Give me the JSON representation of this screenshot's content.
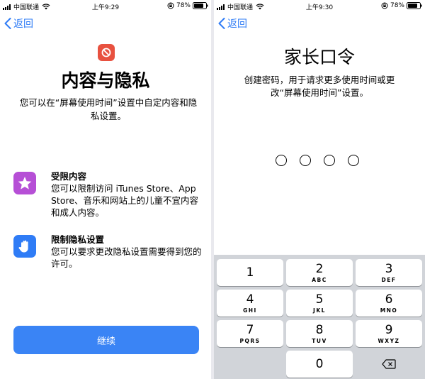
{
  "left": {
    "status": {
      "carrier": "中国联通",
      "time": "上午9:29",
      "battery": "78%"
    },
    "back_label": "返回",
    "title": "内容与隐私",
    "description": "您可以在“屏幕使用时间”设置中自定内容和隐私设置。",
    "features": [
      {
        "icon": "star-icon",
        "title": "受限内容",
        "desc": "您可以限制访问 iTunes Store、App Store、音乐和网站上的儿童不宜内容和成人内容。"
      },
      {
        "icon": "hand-icon",
        "title": "限制隐私设置",
        "desc": "您可以要求更改隐私设置需要得到您的许可。"
      }
    ],
    "continue_label": "继续",
    "colors": {
      "accent": "#3a84f5",
      "hero": "#e8513f",
      "star_bg": "#b64fd6",
      "hand_bg": "#2f7cf6"
    }
  },
  "right": {
    "status": {
      "carrier": "中国联通",
      "time": "上午9:30",
      "battery": "78%"
    },
    "back_label": "返回",
    "title": "家长口令",
    "description": "创建密码，用于请求更多使用时间或更改“屏幕使用时间”设置。",
    "keys": [
      {
        "num": "1",
        "letters": ""
      },
      {
        "num": "2",
        "letters": "ABC"
      },
      {
        "num": "3",
        "letters": "DEF"
      },
      {
        "num": "4",
        "letters": "GHI"
      },
      {
        "num": "5",
        "letters": "JKL"
      },
      {
        "num": "6",
        "letters": "MNO"
      },
      {
        "num": "7",
        "letters": "PQRS"
      },
      {
        "num": "8",
        "letters": "TUV"
      },
      {
        "num": "9",
        "letters": "WXYZ"
      },
      {
        "num": "0",
        "letters": ""
      }
    ]
  }
}
